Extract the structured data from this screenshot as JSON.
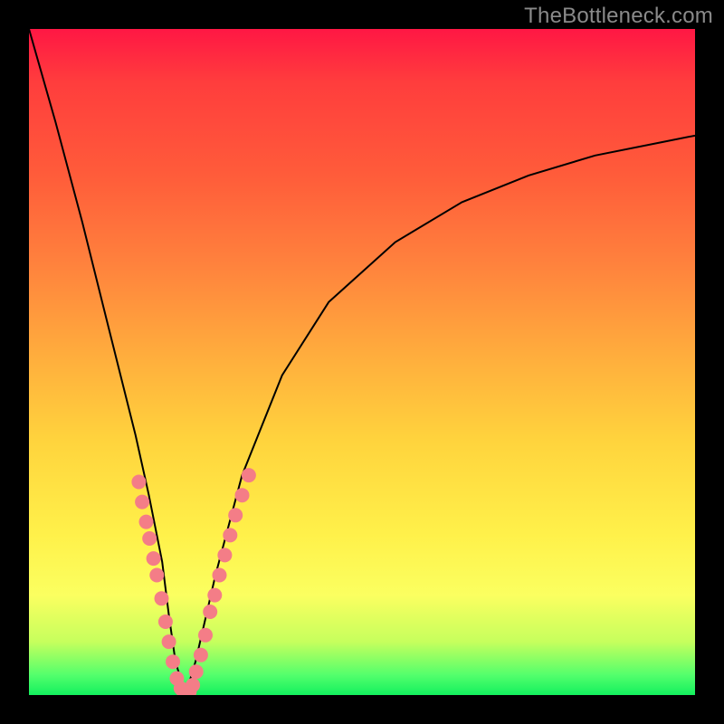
{
  "watermark": "TheBottleneck.com",
  "chart_data": {
    "type": "line",
    "title": "",
    "xlabel": "",
    "ylabel": "",
    "xlim": [
      0,
      100
    ],
    "ylim": [
      0,
      100
    ],
    "series": [
      {
        "name": "main-curve",
        "x": [
          0,
          4,
          8,
          12,
          16,
          18,
          20,
          21,
          22,
          23.5,
          25,
          28,
          32,
          38,
          45,
          55,
          65,
          75,
          85,
          95,
          100
        ],
        "y": [
          100,
          86,
          71,
          55,
          39,
          30,
          20,
          12,
          5,
          0,
          5,
          18,
          33,
          48,
          59,
          68,
          74,
          78,
          81,
          83,
          84
        ]
      }
    ],
    "marker_clusters": {
      "left_branch_x": [
        16.5,
        17,
        17.6,
        18.1,
        18.7,
        19.2,
        19.9,
        20.5,
        21.0,
        21.6,
        22.2,
        22.8,
        23.3
      ],
      "left_branch_y": [
        32,
        29,
        26,
        23.5,
        20.5,
        18,
        14.5,
        11,
        8,
        5,
        2.5,
        1,
        0
      ],
      "right_branch_x": [
        24.1,
        24.6,
        25.1,
        25.8,
        26.5,
        27.2,
        27.9,
        28.6,
        29.4,
        30.2,
        31.0,
        32.0,
        33.0
      ],
      "right_branch_y": [
        0.5,
        1.5,
        3.5,
        6,
        9,
        12.5,
        15,
        18,
        21,
        24,
        27,
        30,
        33
      ]
    },
    "gradient_stops": [
      {
        "pct": 0,
        "color": "#ff1744"
      },
      {
        "pct": 50,
        "color": "#ffd43d"
      },
      {
        "pct": 85,
        "color": "#fbff60"
      },
      {
        "pct": 100,
        "color": "#13f05e"
      }
    ]
  }
}
